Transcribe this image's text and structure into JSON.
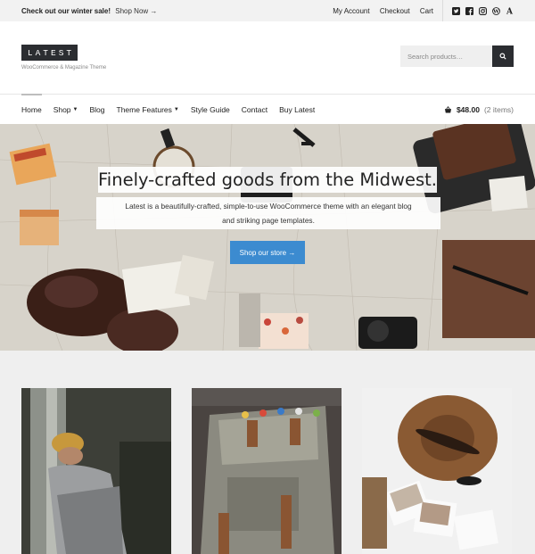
{
  "topbar": {
    "promo_label": "Check out our winter sale!",
    "promo_link": "Shop Now →",
    "links": [
      "My Account",
      "Checkout",
      "Cart"
    ],
    "social_icons": [
      "twitter-icon",
      "facebook-icon",
      "instagram-icon",
      "wordpress-icon",
      "font-a-icon"
    ]
  },
  "header": {
    "logo": "LATEST",
    "tagline": "WooCommerce & Magazine Theme",
    "search_placeholder": "Search products…"
  },
  "nav": {
    "items": [
      {
        "label": "Home"
      },
      {
        "label": "Shop"
      },
      {
        "label": "Blog"
      },
      {
        "label": "Theme Features"
      },
      {
        "label": "Style Guide"
      },
      {
        "label": "Contact"
      },
      {
        "label": "Buy Latest"
      }
    ],
    "cart_price": "$48.00",
    "cart_count": "(2 items)"
  },
  "hero": {
    "title": "Finely-crafted goods from the Midwest.",
    "subtitle_line1": "Latest is a beautifully-crafted, simple-to-use WooCommerce theme with an elegant blog",
    "subtitle_line2": "and striking page templates.",
    "cta_label": "Shop our store →",
    "cta_color": "#3c8bd0"
  },
  "colors": {
    "dark": "#2b2d31",
    "accent": "#3c8bd0",
    "page_bg": "#efefef"
  }
}
